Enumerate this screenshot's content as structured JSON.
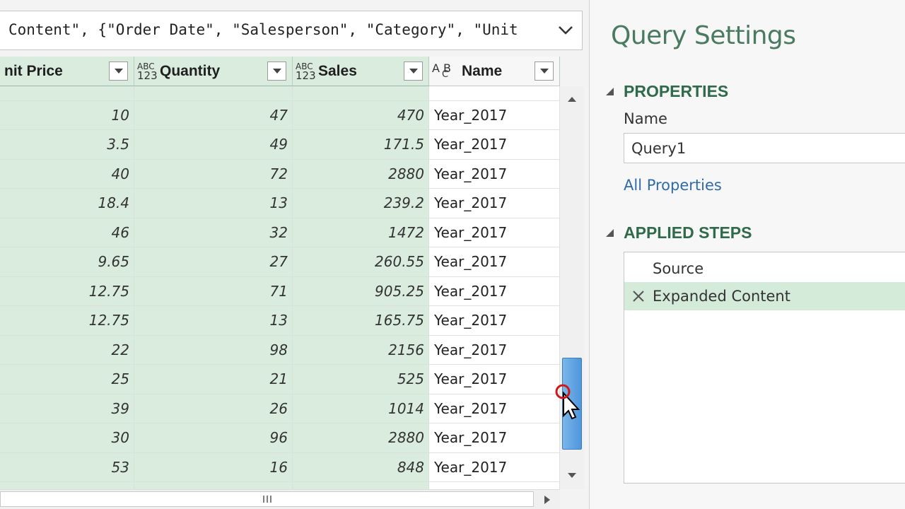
{
  "formula_bar": {
    "text": "Content\", {\"Order Date\", \"Salesperson\", \"Category\", \"Unit"
  },
  "columns": [
    {
      "label": "nit Price",
      "type_top": "",
      "type_bottom": ""
    },
    {
      "label": "Quantity",
      "type_top": "ABC",
      "type_bottom": "123"
    },
    {
      "label": "Sales",
      "type_top": "ABC",
      "type_bottom": "123"
    },
    {
      "label": "Name",
      "type_top": "A B",
      "type_bottom": "C"
    }
  ],
  "rows": [
    [
      "10",
      "47",
      "470",
      "Year_2017"
    ],
    [
      "3.5",
      "49",
      "171.5",
      "Year_2017"
    ],
    [
      "40",
      "72",
      "2880",
      "Year_2017"
    ],
    [
      "18.4",
      "13",
      "239.2",
      "Year_2017"
    ],
    [
      "46",
      "32",
      "1472",
      "Year_2017"
    ],
    [
      "9.65",
      "27",
      "260.55",
      "Year_2017"
    ],
    [
      "12.75",
      "71",
      "905.25",
      "Year_2017"
    ],
    [
      "12.75",
      "13",
      "165.75",
      "Year_2017"
    ],
    [
      "22",
      "98",
      "2156",
      "Year_2017"
    ],
    [
      "25",
      "21",
      "525",
      "Year_2017"
    ],
    [
      "39",
      "26",
      "1014",
      "Year_2017"
    ],
    [
      "30",
      "96",
      "2880",
      "Year_2017"
    ],
    [
      "53",
      "16",
      "848",
      "Year_2017"
    ]
  ],
  "query_settings": {
    "title": "Query Settings",
    "properties_heading": "PROPERTIES",
    "name_label": "Name",
    "name_value": "Query1",
    "all_properties_link": "All Properties",
    "applied_steps_heading": "APPLIED STEPS",
    "steps": [
      "Source",
      "Expanded Content"
    ]
  },
  "colors": {
    "accent_green": "#2f6b4a",
    "column_highlight": "#d9ecde",
    "scroll_thumb": "#4e96dc"
  },
  "icons": [
    "chevron-down-icon",
    "filter-dropdown-icon",
    "scroll-up-icon",
    "scroll-down-icon",
    "scroll-right-icon",
    "collapse-triangle-icon",
    "delete-step-icon",
    "mouse-cursor-icon"
  ]
}
